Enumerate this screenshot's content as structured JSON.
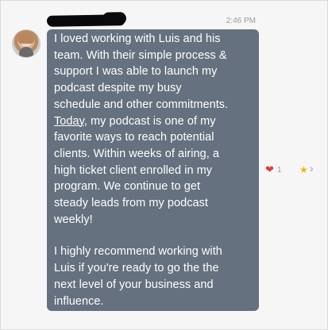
{
  "message": {
    "timestamp": "2:46 PM",
    "lines_para1": [
      "I loved working with Luis and his",
      "team. With their simple process &",
      "support I was able to launch my",
      "podcast despite my busy",
      "schedule and other commitments."
    ],
    "today_word": "Today",
    "lines_para1b": [
      ", my podcast is one of my",
      "favorite ways to reach potential",
      "clients. Within weeks of airing, a",
      "high ticket client enrolled in my",
      "program. We continue to get",
      "steady leads from my podcast",
      "weekly!"
    ],
    "lines_para2": [
      "I highly recommend working with",
      "Luis if you're ready to go the the",
      "next level of your business and",
      "influence."
    ]
  },
  "reactions": {
    "heart_icon": "heart-icon",
    "heart_count": "1",
    "star_icon": "star-icon",
    "more_icon": "chevron-right-icon"
  },
  "colors": {
    "bubble": "#65717e",
    "heart": "#e03b3b",
    "star": "#f0b400"
  }
}
